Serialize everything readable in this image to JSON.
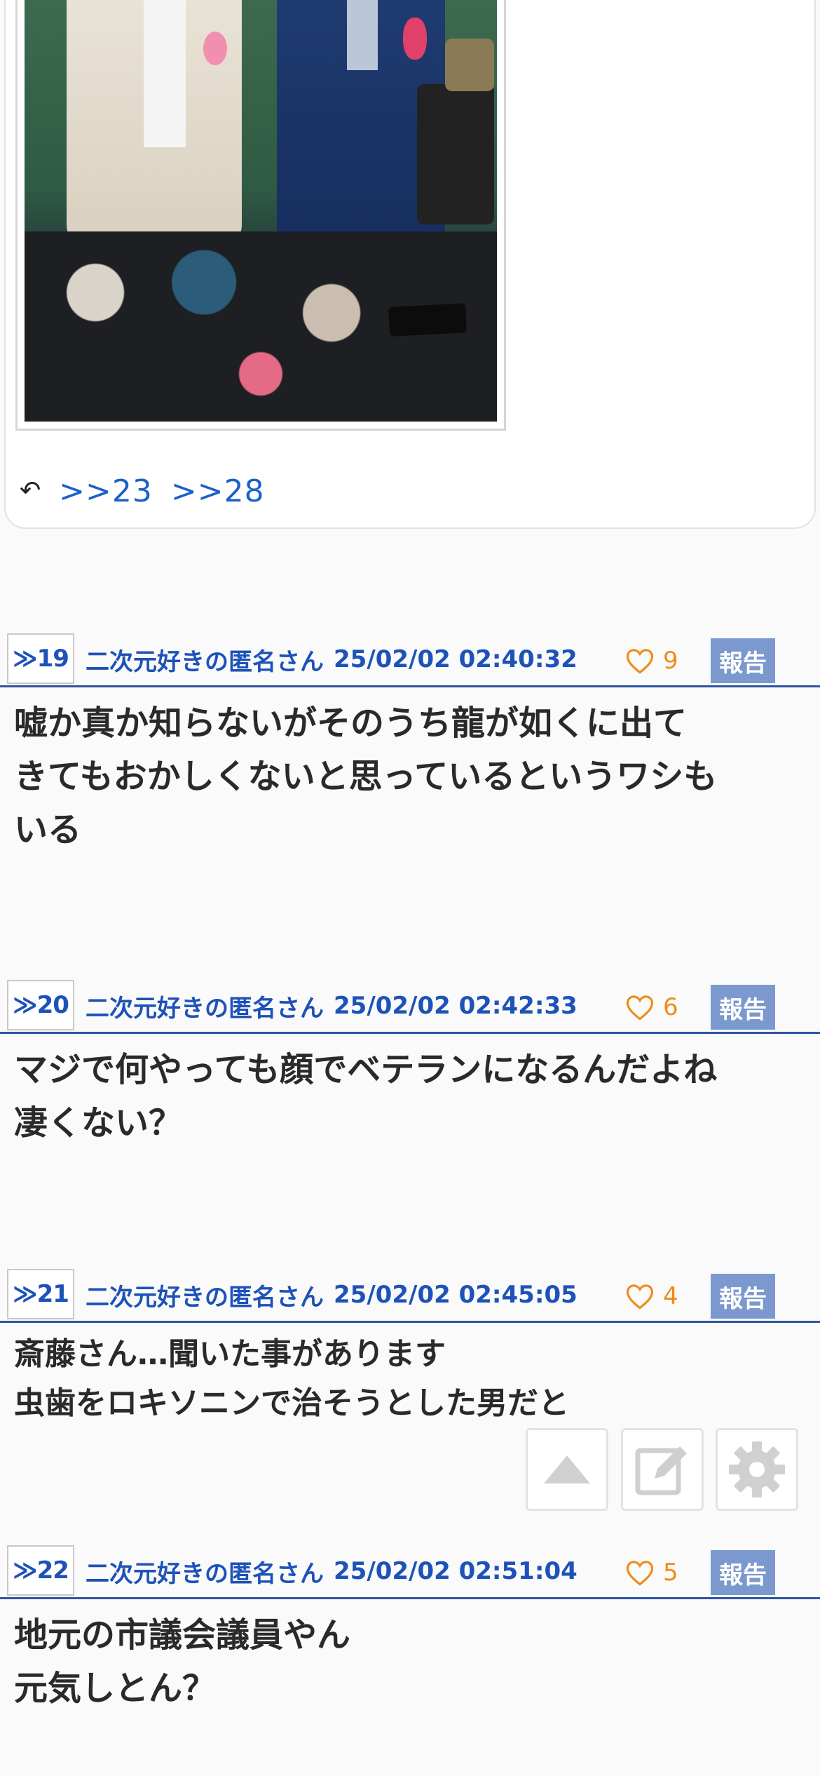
{
  "reply": {
    "anchors": [
      ">>23",
      ">>28"
    ]
  },
  "posts": [
    {
      "number": "≫19",
      "name": "二次元好きの匿名さん",
      "datetime": "25/02/02 02:40:32",
      "likes": "9",
      "report_label": "報告",
      "body": "嘘か真か知らないがそのうち龍が如くに出て\nきてもおかしくないと思っているというワシも\nいる"
    },
    {
      "number": "≫20",
      "name": "二次元好きの匿名さん",
      "datetime": "25/02/02 02:42:33",
      "likes": "6",
      "report_label": "報告",
      "body": "マジで何やっても顔でベテランになるんだよね\n凄くない？"
    },
    {
      "number": "≫21",
      "name": "二次元好きの匿名さん",
      "datetime": "25/02/02 02:45:05",
      "likes": "4",
      "report_label": "報告",
      "body": "斎藤さん…聞いた事があります\n虫歯をロキソニンで治そうとした男だと"
    },
    {
      "number": "≫22",
      "name": "二次元好きの匿名さん",
      "datetime": "25/02/02 02:51:04",
      "likes": "5",
      "report_label": "報告",
      "body": "地元の市議会議員やん\n元気しとん？"
    }
  ],
  "icons": {
    "reply": "reply-icon",
    "like": "heart-icon",
    "scroll_top": "triangle-up-icon",
    "compose": "pencil-square-icon",
    "settings": "gear-icon"
  },
  "colors": {
    "link": "#1b62c7",
    "meta": "#1d52b8",
    "like": "#ee8c1b",
    "report_bg": "#7b99cf",
    "divider": "#2d55a3"
  }
}
